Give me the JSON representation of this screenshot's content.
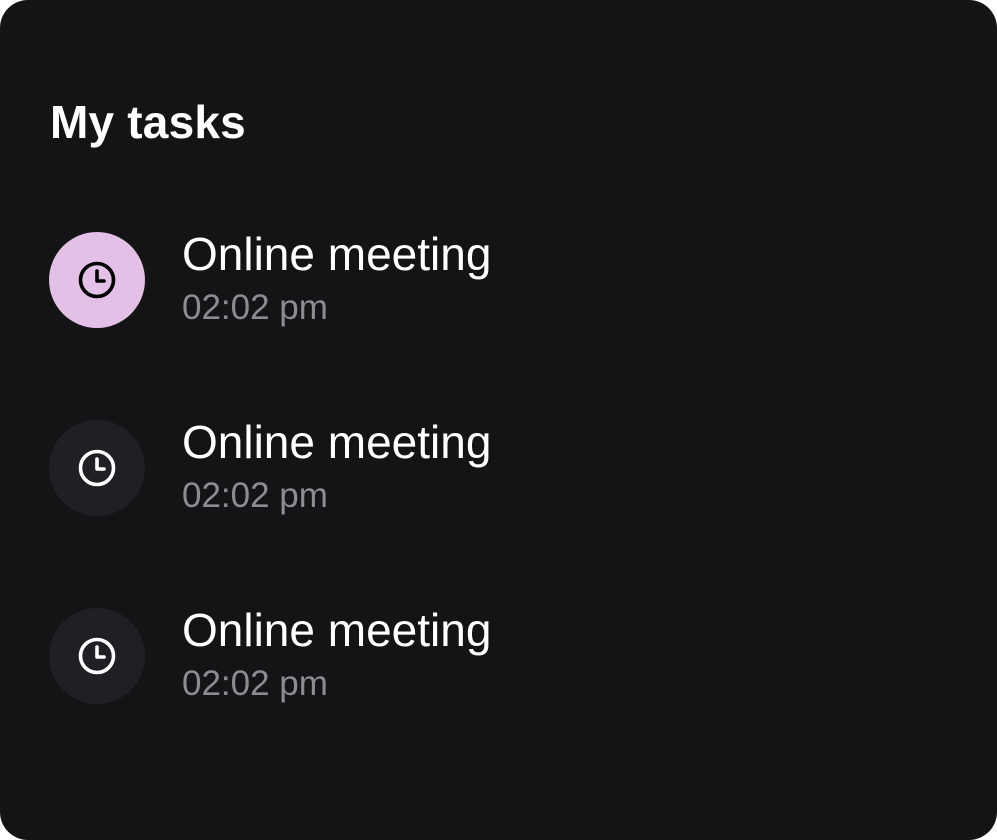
{
  "card": {
    "title": "My tasks",
    "colors": {
      "background": "#141416",
      "active_icon_bg": "#e3c0e6",
      "icon_bg": "#1f2023",
      "time_text": "#8c8d91"
    }
  },
  "tasks": [
    {
      "title": "Online meeting",
      "time": "02:02 pm",
      "icon": "clock-icon",
      "active": true
    },
    {
      "title": "Online meeting",
      "time": "02:02 pm",
      "icon": "clock-icon",
      "active": false
    },
    {
      "title": "Online meeting",
      "time": "02:02 pm",
      "icon": "clock-icon",
      "active": false
    }
  ]
}
